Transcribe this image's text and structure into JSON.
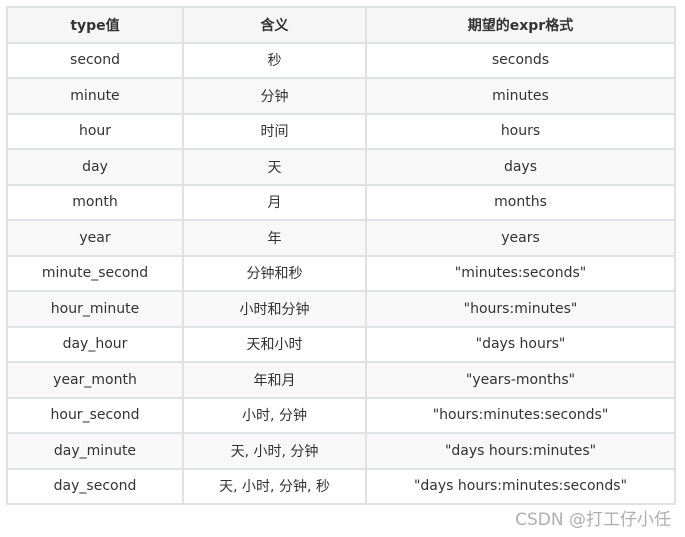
{
  "table": {
    "headers": [
      "type值",
      "含义",
      "期望的expr格式"
    ],
    "rows": [
      [
        "second",
        "秒",
        "seconds"
      ],
      [
        "minute",
        "分钟",
        "minutes"
      ],
      [
        "hour",
        "时间",
        "hours"
      ],
      [
        "day",
        "天",
        "days"
      ],
      [
        "month",
        "月",
        "months"
      ],
      [
        "year",
        "年",
        "years"
      ],
      [
        "minute_second",
        "分钟和秒",
        "\"minutes:seconds\""
      ],
      [
        "hour_minute",
        "小时和分钟",
        "\"hours:minutes\""
      ],
      [
        "day_hour",
        "天和小时",
        "\"days hours\""
      ],
      [
        "year_month",
        "年和月",
        "\"years-months\""
      ],
      [
        "hour_second",
        "小时, 分钟",
        "\"hours:minutes:seconds\""
      ],
      [
        "day_minute",
        "天, 小时, 分钟",
        "\"days hours:minutes\""
      ],
      [
        "day_second",
        "天, 小时, 分钟, 秒",
        "\"days hours:minutes:seconds\""
      ]
    ]
  },
  "watermark": "CSDN @打工仔小任"
}
